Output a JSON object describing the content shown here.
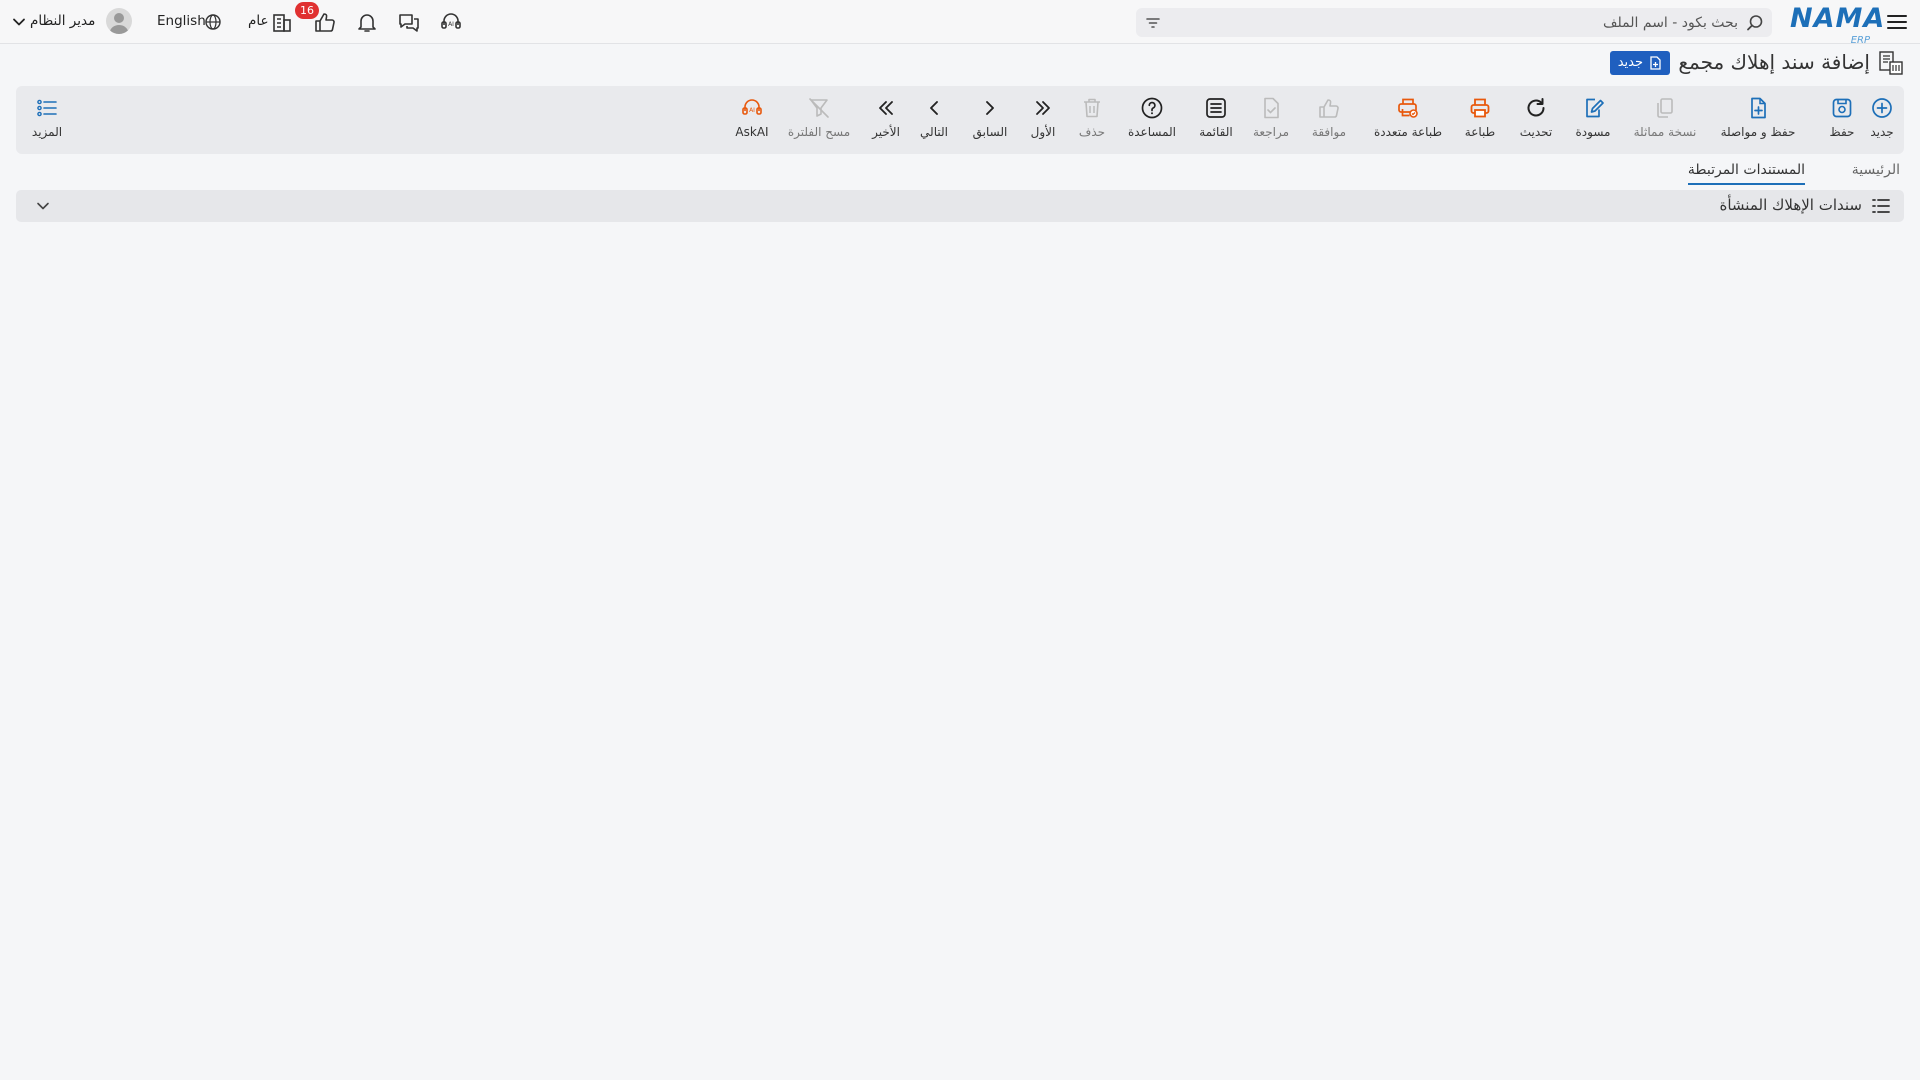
{
  "header": {
    "logo_text": "NAMA",
    "logo_sub": "ERP",
    "search_placeholder": "بحث بكود - اسم الملف",
    "general_label": "عام",
    "notification_count": "16",
    "language_label": "English",
    "user_name": "مدير النظام"
  },
  "page": {
    "title": "إضافة سند إهلاك مجمع",
    "status_label": "جديد"
  },
  "toolbar": {
    "new_label": "جديد",
    "save_label": "حفظ",
    "save_continue_label": "حفظ و مواصلة",
    "copy_label": "نسخة مماثلة",
    "draft_label": "مسودة",
    "refresh_label": "تحديث",
    "print_label": "طباعة",
    "multi_print_label": "طباعة متعددة",
    "approve_label": "موافقة",
    "review_label": "مراجعة",
    "list_label": "القائمة",
    "help_label": "المساعدة",
    "delete_label": "حذف",
    "first_label": "الأول",
    "prev_label": "السابق",
    "next_label": "التالي",
    "last_label": "الأخير",
    "clear_filter_label": "مسح الفلترة",
    "askai_label": "AskAI",
    "more_label": "المزيد"
  },
  "tabs": {
    "main_label": "الرئيسية",
    "related_label": "المستندات المرتبطة"
  },
  "section": {
    "title": "سندات الإهلاك المنشأة"
  },
  "colors": {
    "primary": "#1d6fb8",
    "badge_blue": "#1f5fbf",
    "print_orange": "#e8580c",
    "notification_red": "#e03131"
  }
}
